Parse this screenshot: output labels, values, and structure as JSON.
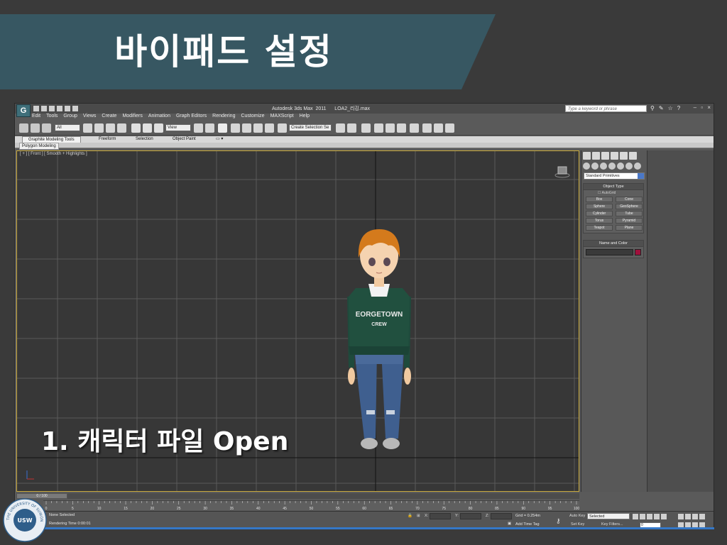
{
  "slide": {
    "title": "바이패드 설정",
    "step_text": "1.  캐릭터 파일 Open",
    "banner_color": "#375762"
  },
  "app": {
    "logo_letter": "G",
    "window_title": "Autodesk 3ds Max  2011      LOA2_리깅.max",
    "search_placeholder": "Type a keyword or phrase",
    "window_controls": "– ▫ ×",
    "menu": [
      "Edit",
      "Tools",
      "Group",
      "Views",
      "Create",
      "Modifiers",
      "Animation",
      "Graph Editors",
      "Rendering",
      "Customize",
      "MAXScript",
      "Help"
    ],
    "toolbar": {
      "selection_filter": "All",
      "ref_coord": "View",
      "named_selection": "Create Selection Se"
    },
    "ribbon_tabs": [
      "Graphite Modeling Tools",
      "Freeform",
      "Selection",
      "Object Paint"
    ],
    "ribbon_sub": "Polygon Modeling",
    "viewport_label": "[ + ] [ Front ] [ Smooth + Highlights ]",
    "command_panel": {
      "category": "Standard Primitives",
      "object_type_title": "Object Type",
      "autogrid_label": "AutoGrid",
      "objects": [
        "Box",
        "Cone",
        "Sphere",
        "GeoSphere",
        "Cylinder",
        "Tube",
        "Torus",
        "Pyramid",
        "Teapot",
        "Plane"
      ],
      "name_color_title": "Name and Color",
      "swatch_color": "#a0103c"
    },
    "timeline": {
      "slider_label": "0 / 100",
      "ticks": [
        "0",
        "5",
        "10",
        "15",
        "20",
        "25",
        "30",
        "35",
        "40",
        "45",
        "50",
        "55",
        "60",
        "65",
        "70",
        "75",
        "80",
        "85",
        "90",
        "95",
        "100"
      ]
    },
    "status": {
      "selection": "None Selected",
      "render_time": "Rendering Time  0:00:01",
      "x_label": "X:",
      "y_label": "Y:",
      "z_label": "Z:",
      "grid": "Grid = 0.254m",
      "add_time_tag": "Add Time Tag",
      "auto_key": "Auto Key",
      "set_key": "Set Key",
      "key_mode": "Selected",
      "key_filters": "Key Filters...",
      "frame": "0"
    }
  },
  "character": {
    "shirt_text_top": "EORGETOWN",
    "shirt_text_bottom": "CREW"
  },
  "seal": {
    "ring_text": "THE UNIVERSITY OF SUWON",
    "center_text": "USW"
  }
}
